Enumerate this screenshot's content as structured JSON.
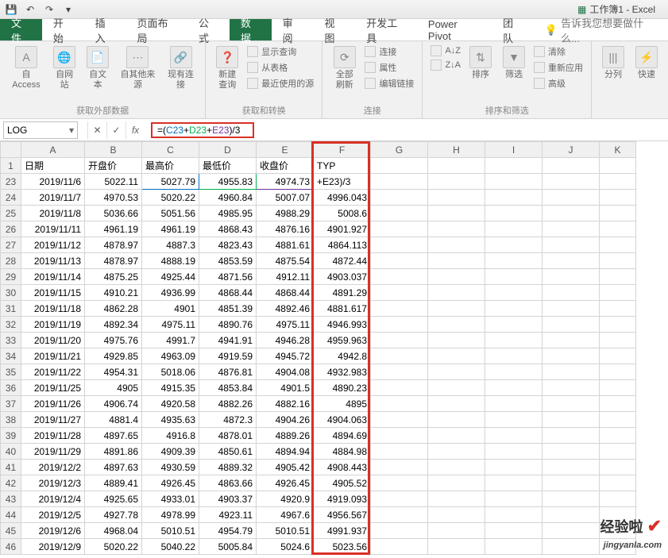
{
  "app": {
    "title": "工作簿1 - Excel"
  },
  "tabs": {
    "file": "文件",
    "home": "开始",
    "insert": "插入",
    "layout": "页面布局",
    "formula": "公式",
    "data": "数据",
    "review": "审阅",
    "view": "视图",
    "dev": "开发工具",
    "pivot": "Power Pivot",
    "team": "团队",
    "tell": "告诉我您想要做什么..."
  },
  "ribbon": {
    "g1": {
      "access": "自 Access",
      "web": "自网站",
      "text": "自文本",
      "other": "自其他来源",
      "exist": "现有连接",
      "label": "获取外部数据"
    },
    "g2": {
      "newq": "新建\n查询",
      "show": "显示查询",
      "table": "从表格",
      "recent": "最近使用的源",
      "label": "获取和转换"
    },
    "g3": {
      "refresh": "全部刷新",
      "conn": "连接",
      "prop": "属性",
      "edit": "编辑链接",
      "label": "连接"
    },
    "g4": {
      "sortaz": "A↓Z",
      "sortza": "Z↓A",
      "sort": "排序",
      "filter": "筛选",
      "clear": "清除",
      "reapply": "重新应用",
      "adv": "高级",
      "label": "排序和筛选"
    },
    "g5": {
      "split": "分列",
      "fast": "快速"
    }
  },
  "fx": {
    "name": "LOG",
    "formula_display": "=(C23+D23+E23)/3",
    "c1": "C23",
    "c2": "D23",
    "c3": "E23",
    "tail": ")/3"
  },
  "headers": [
    "A",
    "B",
    "C",
    "D",
    "E",
    "F",
    "G",
    "H",
    "I",
    "J",
    "K"
  ],
  "row1": {
    "A": "日期",
    "B": "开盘价",
    "C": "最高价",
    "D": "最低价",
    "E": "收盘价",
    "F": "TYP"
  },
  "firstRowNum": "1",
  "rownums": [
    "23",
    "24",
    "25",
    "26",
    "27",
    "28",
    "29",
    "30",
    "31",
    "32",
    "33",
    "34",
    "35",
    "36",
    "37",
    "38",
    "39",
    "40",
    "41",
    "42",
    "43",
    "44",
    "45",
    "46"
  ],
  "rows": [
    {
      "A": "2019/11/6",
      "B": "5022.11",
      "C": "5027.79",
      "D": "4955.83",
      "E": "4974.73",
      "F": "+E23)/3"
    },
    {
      "A": "2019/11/7",
      "B": "4970.53",
      "C": "5020.22",
      "D": "4960.84",
      "E": "5007.07",
      "F": "4996.043"
    },
    {
      "A": "2019/11/8",
      "B": "5036.66",
      "C": "5051.56",
      "D": "4985.95",
      "E": "4988.29",
      "F": "5008.6"
    },
    {
      "A": "2019/11/11",
      "B": "4961.19",
      "C": "4961.19",
      "D": "4868.43",
      "E": "4876.16",
      "F": "4901.927"
    },
    {
      "A": "2019/11/12",
      "B": "4878.97",
      "C": "4887.3",
      "D": "4823.43",
      "E": "4881.61",
      "F": "4864.113"
    },
    {
      "A": "2019/11/13",
      "B": "4878.97",
      "C": "4888.19",
      "D": "4853.59",
      "E": "4875.54",
      "F": "4872.44"
    },
    {
      "A": "2019/11/14",
      "B": "4875.25",
      "C": "4925.44",
      "D": "4871.56",
      "E": "4912.11",
      "F": "4903.037"
    },
    {
      "A": "2019/11/15",
      "B": "4910.21",
      "C": "4936.99",
      "D": "4868.44",
      "E": "4868.44",
      "F": "4891.29"
    },
    {
      "A": "2019/11/18",
      "B": "4862.28",
      "C": "4901",
      "D": "4851.39",
      "E": "4892.46",
      "F": "4881.617"
    },
    {
      "A": "2019/11/19",
      "B": "4892.34",
      "C": "4975.11",
      "D": "4890.76",
      "E": "4975.11",
      "F": "4946.993"
    },
    {
      "A": "2019/11/20",
      "B": "4975.76",
      "C": "4991.7",
      "D": "4941.91",
      "E": "4946.28",
      "F": "4959.963"
    },
    {
      "A": "2019/11/21",
      "B": "4929.85",
      "C": "4963.09",
      "D": "4919.59",
      "E": "4945.72",
      "F": "4942.8"
    },
    {
      "A": "2019/11/22",
      "B": "4954.31",
      "C": "5018.06",
      "D": "4876.81",
      "E": "4904.08",
      "F": "4932.983"
    },
    {
      "A": "2019/11/25",
      "B": "4905",
      "C": "4915.35",
      "D": "4853.84",
      "E": "4901.5",
      "F": "4890.23"
    },
    {
      "A": "2019/11/26",
      "B": "4906.74",
      "C": "4920.58",
      "D": "4882.26",
      "E": "4882.16",
      "F": "4895"
    },
    {
      "A": "2019/11/27",
      "B": "4881.4",
      "C": "4935.63",
      "D": "4872.3",
      "E": "4904.26",
      "F": "4904.063"
    },
    {
      "A": "2019/11/28",
      "B": "4897.65",
      "C": "4916.8",
      "D": "4878.01",
      "E": "4889.26",
      "F": "4894.69"
    },
    {
      "A": "2019/11/29",
      "B": "4891.86",
      "C": "4909.39",
      "D": "4850.61",
      "E": "4894.94",
      "F": "4884.98"
    },
    {
      "A": "2019/12/2",
      "B": "4897.63",
      "C": "4930.59",
      "D": "4889.32",
      "E": "4905.42",
      "F": "4908.443"
    },
    {
      "A": "2019/12/3",
      "B": "4889.41",
      "C": "4926.45",
      "D": "4863.66",
      "E": "4926.45",
      "F": "4905.52"
    },
    {
      "A": "2019/12/4",
      "B": "4925.65",
      "C": "4933.01",
      "D": "4903.37",
      "E": "4920.9",
      "F": "4919.093"
    },
    {
      "A": "2019/12/5",
      "B": "4927.78",
      "C": "4978.99",
      "D": "4923.11",
      "E": "4967.6",
      "F": "4956.567"
    },
    {
      "A": "2019/12/6",
      "B": "4968.04",
      "C": "5010.51",
      "D": "4954.79",
      "E": "5010.51",
      "F": "4991.937"
    },
    {
      "A": "2019/12/9",
      "B": "5020.22",
      "C": "5040.22",
      "D": "5005.84",
      "E": "5024.6",
      "F": "5023.56"
    }
  ],
  "watermark": {
    "main": "经验啦",
    "sub": "jingyanla.com"
  }
}
